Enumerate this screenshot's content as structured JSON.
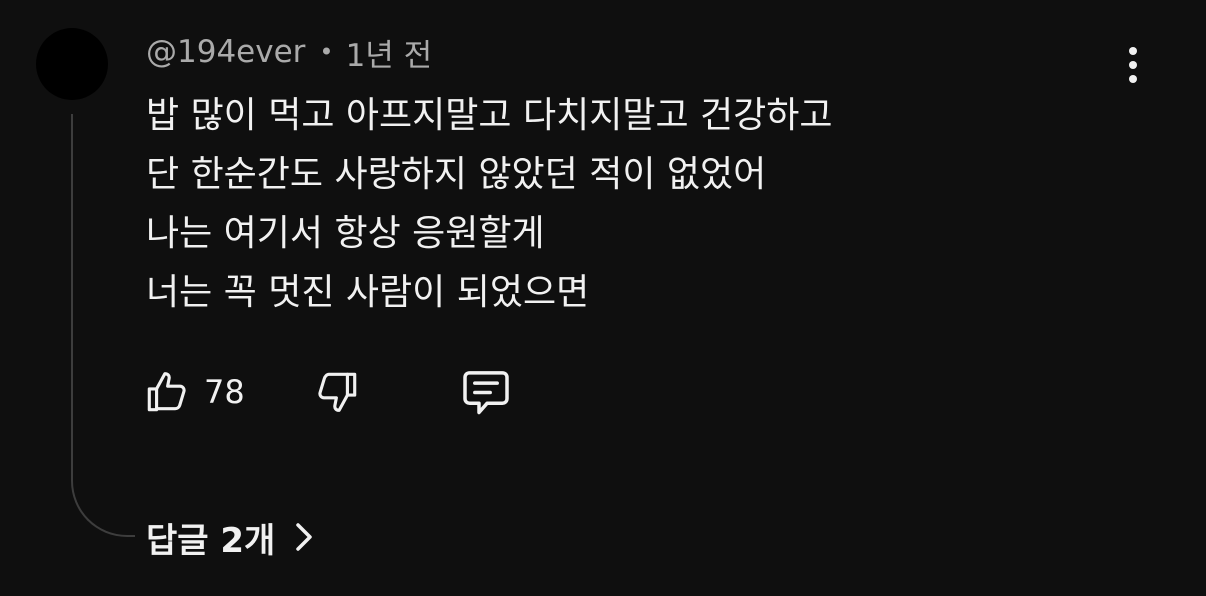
{
  "comment": {
    "author": "@194ever",
    "separator": "•",
    "time": "1년 전",
    "lines": [
      "밥 많이 먹고 아프지말고 다치지말고 건강하고",
      "단 한순간도 사랑하지 않았던 적이 없었어",
      "나는 여기서 항상 응원할게",
      "너는 꼭 멋진 사람이 되었으면"
    ],
    "like_count": "78",
    "replies_label": "답글 2개"
  },
  "icons": {
    "menu": "more-vertical-icon",
    "like": "thumbs-up-icon",
    "dislike": "thumbs-down-icon",
    "reply": "comment-icon",
    "expand": "chevron-right-icon"
  },
  "colors": {
    "background": "#0f0f0f",
    "text": "#f1f1f1",
    "secondary_text": "#aaaaaa",
    "thread_line": "#3d3d3d",
    "avatar": "#000000"
  }
}
